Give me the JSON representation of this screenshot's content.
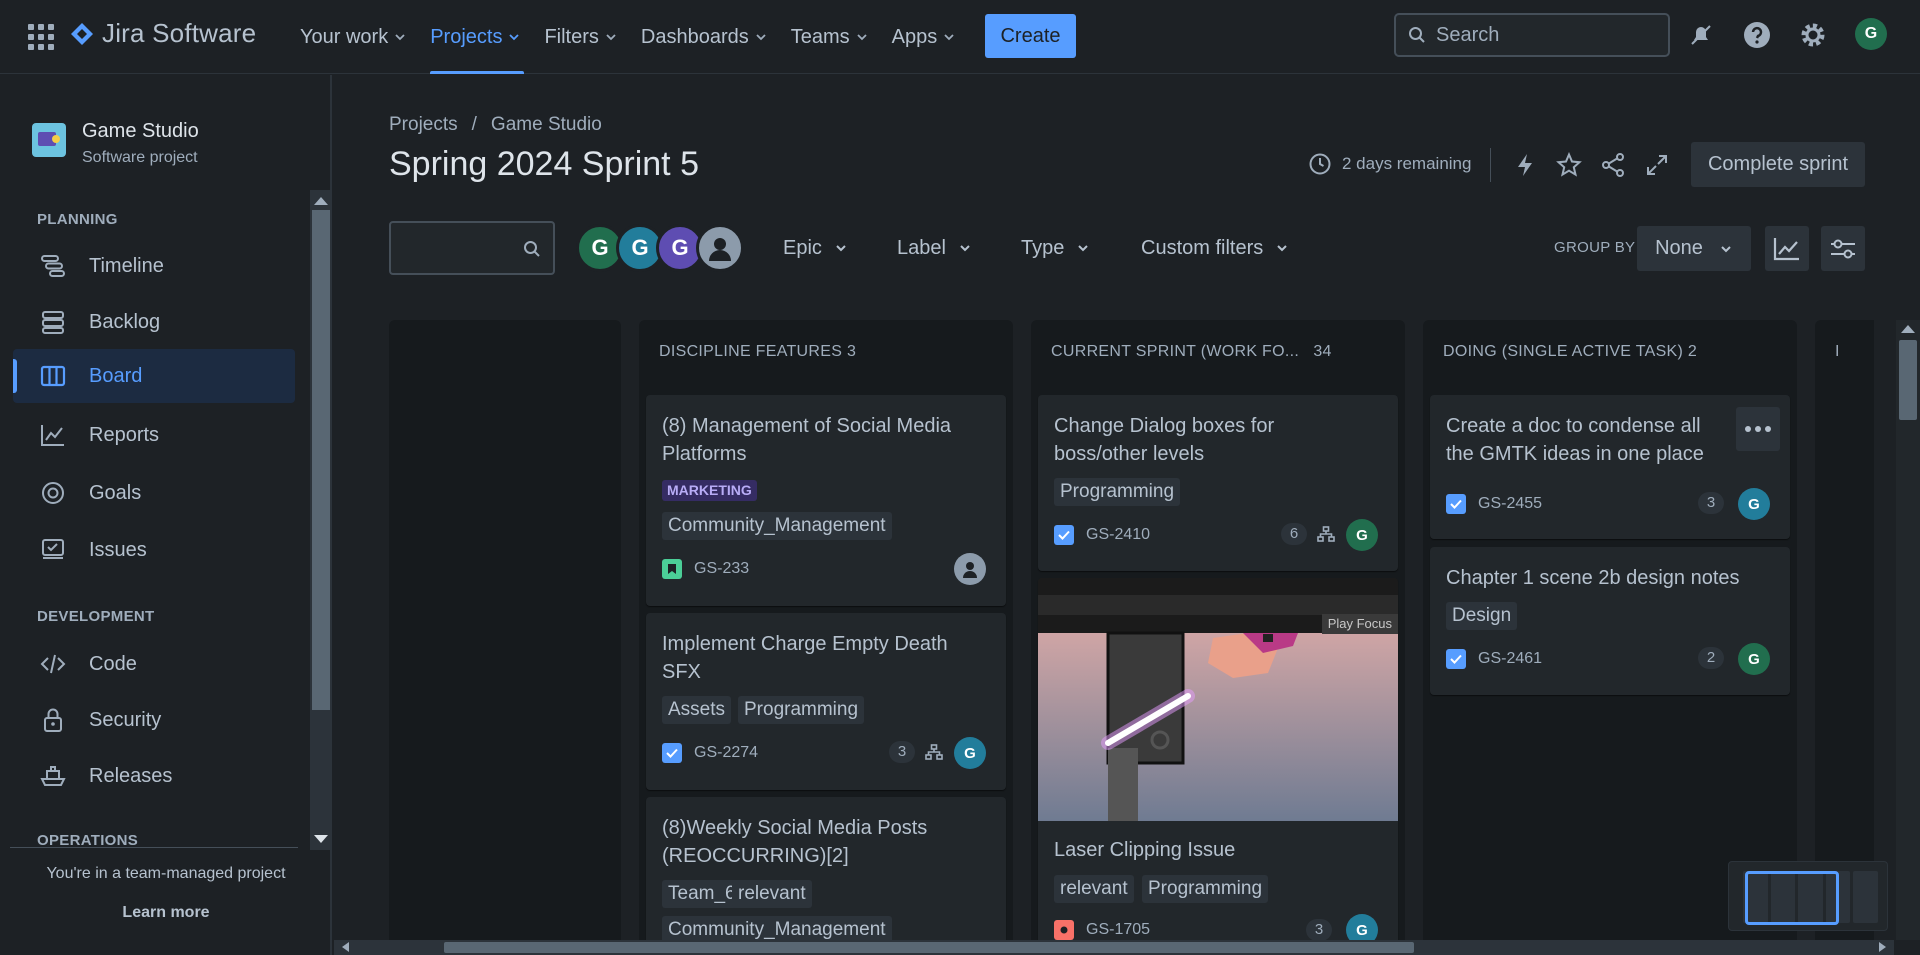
{
  "topnav": {
    "product": "Jira Software",
    "items": [
      {
        "label": "Your work"
      },
      {
        "label": "Projects"
      },
      {
        "label": "Filters"
      },
      {
        "label": "Dashboards"
      },
      {
        "label": "Teams"
      },
      {
        "label": "Apps"
      }
    ],
    "active_item": "Projects",
    "create_label": "Create",
    "search_placeholder": "Search",
    "user_initial": "G"
  },
  "sidebar": {
    "project_name": "Game Studio",
    "project_type": "Software project",
    "sections": {
      "planning": "PLANNING",
      "development": "DEVELOPMENT",
      "operations": "OPERATIONS"
    },
    "planning_items": [
      {
        "label": "Timeline",
        "icon": "timeline-icon"
      },
      {
        "label": "Backlog",
        "icon": "backlog-icon"
      },
      {
        "label": "Board",
        "icon": "board-icon",
        "active": true
      },
      {
        "label": "Reports",
        "icon": "reports-icon"
      },
      {
        "label": "Goals",
        "icon": "goals-icon"
      },
      {
        "label": "Issues",
        "icon": "issues-icon"
      }
    ],
    "development_items": [
      {
        "label": "Code",
        "icon": "code-icon"
      },
      {
        "label": "Security",
        "icon": "lock-icon"
      },
      {
        "label": "Releases",
        "icon": "ship-icon"
      }
    ],
    "team_note": "You're in a team-managed project",
    "learn_more": "Learn more"
  },
  "header": {
    "breadcrumb": [
      "Projects",
      "Game Studio"
    ],
    "breadcrumb_sep": "/",
    "title": "Spring 2024 Sprint 5",
    "remaining": "2 days remaining",
    "complete_sprint": "Complete sprint"
  },
  "filters": {
    "avatars": [
      {
        "initial": "G",
        "color": "#216e4e"
      },
      {
        "initial": "G",
        "color": "#227d9b"
      },
      {
        "initial": "G",
        "color": "#5e4db2"
      }
    ],
    "dropdowns": [
      "Epic",
      "Label",
      "Type",
      "Custom filters"
    ],
    "group_by_label": "GROUP BY",
    "group_by_value": "None"
  },
  "columns": [
    {
      "title": "DISCIPLINE FEATURES 3"
    },
    {
      "title": "CURRENT SPRINT (WORK FO...",
      "count": "34"
    },
    {
      "title": "DOING (SINGLE ACTIVE TASK) 2"
    },
    {
      "title": "I"
    }
  ],
  "cards": {
    "c1": {
      "title": "(8) Management of Social Media Platforms",
      "lozenge": "MARKETING",
      "labels": [
        "Community_Management"
      ],
      "key": "GS-233",
      "type": "story"
    },
    "c2": {
      "title": "Implement Charge Empty Death SFX",
      "labels": [
        "Assets",
        "Programming"
      ],
      "key": "GS-2274",
      "estimate": "3",
      "type": "task",
      "assignee": "G"
    },
    "c3": {
      "title": "(8)Weekly Social Media Posts (REOCCURRING)[2]",
      "labels": [
        "Team_6",
        "relevant",
        "Community_Management"
      ]
    },
    "c4": {
      "title": "Change Dialog boxes for boss/other levels",
      "labels": [
        "Programming"
      ],
      "key": "GS-2410",
      "estimate": "6",
      "type": "task",
      "assignee": "G"
    },
    "c5": {
      "title": "Laser Clipping Issue",
      "labels": [
        "relevant",
        "Programming"
      ],
      "key": "GS-1705",
      "estimate": "3",
      "type": "bug",
      "assignee": "G",
      "image_caption": "Play Focus"
    },
    "c6": {
      "title": "Create a doc to condense all the GMTK ideas in one place",
      "key": "GS-2455",
      "estimate": "3",
      "type": "task",
      "assignee": "G"
    },
    "c7": {
      "title": "Chapter 1 scene 2b design notes",
      "labels": [
        "Design"
      ],
      "key": "GS-2461",
      "estimate": "2",
      "type": "task",
      "assignee": "G"
    }
  },
  "colors": {
    "accent": "#579dff",
    "background": "#1d2125",
    "column": "#161a1d",
    "card": "#22272b"
  }
}
